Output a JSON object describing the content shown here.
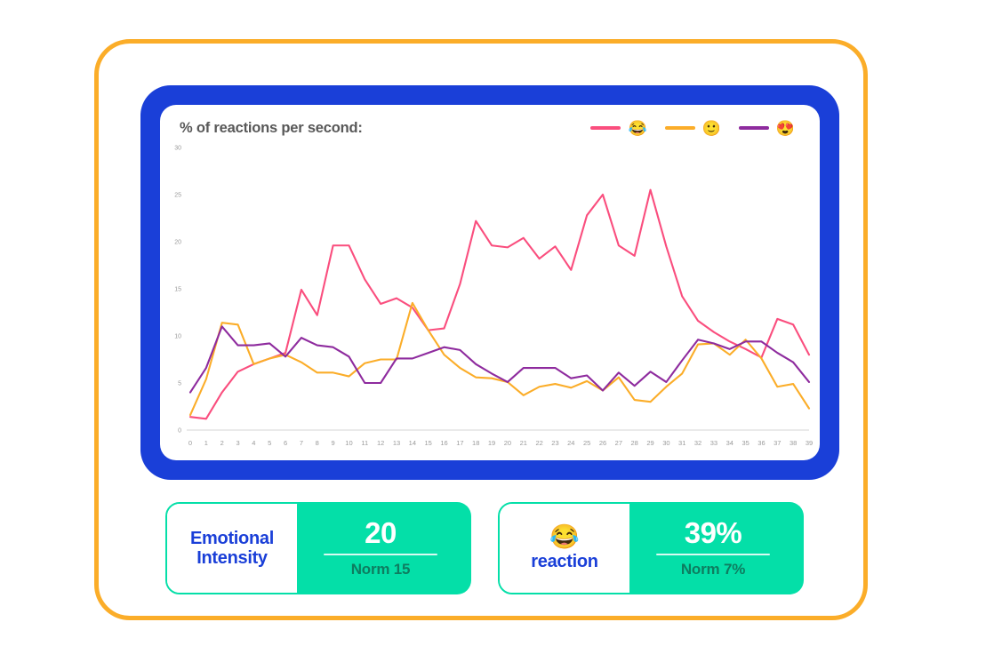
{
  "frame": {
    "outer_border_color": "#FBAD29",
    "device_border_color": "#1A3FD8",
    "screen_color": "#ffffff"
  },
  "chart_header": {
    "title": "% of reactions per second:",
    "legend": [
      {
        "color": "#FA4E7E",
        "emoji": "😂",
        "icon": "face-with-tears-of-joy-emoji",
        "name": "laughing"
      },
      {
        "color": "#FBAD29",
        "emoji": "🙂",
        "icon": "slightly-smiling-face-emoji",
        "name": "smiling"
      },
      {
        "color": "#8E2B9E",
        "emoji": "😍",
        "icon": "smiling-face-with-heart-eyes-emoji",
        "name": "in-love"
      }
    ]
  },
  "chart_data": {
    "type": "line",
    "title": "% of reactions per second:",
    "xlabel": "",
    "ylabel": "",
    "xlim": [
      0,
      39
    ],
    "ylim": [
      0,
      30
    ],
    "grid": false,
    "legend_position": "top-right",
    "yticks": [
      0,
      5,
      10,
      15,
      20,
      25,
      30
    ],
    "x": [
      0,
      1,
      2,
      3,
      4,
      5,
      6,
      7,
      8,
      9,
      10,
      11,
      12,
      13,
      14,
      15,
      16,
      17,
      18,
      19,
      20,
      21,
      22,
      23,
      24,
      25,
      26,
      27,
      28,
      29,
      30,
      31,
      32,
      33,
      34,
      35,
      36,
      37,
      38,
      39
    ],
    "xticks": [
      "0",
      "1",
      "2",
      "3",
      "4",
      "5",
      "6",
      "7",
      "8",
      "9",
      "10",
      "11",
      "12",
      "13",
      "14",
      "15",
      "16",
      "17",
      "18",
      "19",
      "20",
      "21",
      "22",
      "23",
      "24",
      "25",
      "26",
      "27",
      "28",
      "29",
      "30",
      "31",
      "32",
      "33",
      "34",
      "35",
      "36",
      "37",
      "38",
      "39"
    ],
    "series": [
      {
        "name": "😂",
        "label": "laughing",
        "color": "#FA4E7E",
        "values": [
          1.4,
          1.2,
          4.0,
          6.2,
          7.0,
          7.6,
          8.2,
          14.9,
          12.2,
          19.6,
          19.6,
          16.0,
          13.4,
          14.0,
          13.0,
          10.6,
          10.8,
          15.5,
          22.2,
          19.6,
          19.4,
          20.4,
          18.2,
          19.5,
          17.0,
          22.8,
          25.0,
          19.6,
          18.5,
          25.5,
          19.5,
          14.2,
          11.6,
          10.4,
          9.4,
          8.6,
          7.7,
          11.8,
          11.2,
          8.0
        ]
      },
      {
        "name": "🙂",
        "label": "smiling",
        "color": "#FBAD29",
        "values": [
          1.6,
          5.4,
          11.4,
          11.2,
          7.0,
          7.6,
          8.0,
          7.2,
          6.1,
          6.1,
          5.7,
          7.1,
          7.5,
          7.5,
          13.5,
          10.6,
          8.0,
          6.6,
          5.6,
          5.5,
          5.1,
          3.7,
          4.6,
          4.9,
          4.5,
          5.2,
          4.2,
          5.6,
          3.2,
          3.0,
          4.6,
          6.0,
          9.1,
          9.2,
          8.0,
          9.6,
          7.6,
          4.6,
          4.9,
          2.3
        ]
      },
      {
        "name": "😍",
        "label": "in-love",
        "color": "#8E2B9E",
        "values": [
          4.0,
          6.6,
          11.0,
          9.0,
          9.0,
          9.2,
          7.8,
          9.8,
          9.0,
          8.8,
          7.8,
          5.0,
          5.0,
          7.6,
          7.6,
          8.2,
          8.8,
          8.5,
          7.0,
          6.0,
          5.1,
          6.6,
          6.6,
          6.6,
          5.5,
          5.8,
          4.2,
          6.1,
          4.7,
          6.2,
          5.1,
          7.4,
          9.6,
          9.2,
          8.6,
          9.4,
          9.4,
          8.2,
          7.2,
          5.1
        ]
      }
    ]
  },
  "cards": [
    {
      "id": "emotional-intensity",
      "label": "Emotional\nIntensity",
      "label_line1": "Emotional",
      "label_line2": "Intensity",
      "emoji": "",
      "value": "20",
      "norm": "Norm 15",
      "accent_color": "#04DFA8",
      "label_color": "#1A3FD8"
    },
    {
      "id": "laugh-reaction",
      "label": "reaction",
      "label_line1": "reaction",
      "label_line2": "",
      "emoji": "😂",
      "emoji_icon": "face-with-tears-of-joy-emoji",
      "value": "39%",
      "norm": "Norm 7%",
      "accent_color": "#04DFA8",
      "label_color": "#1A3FD8"
    }
  ]
}
